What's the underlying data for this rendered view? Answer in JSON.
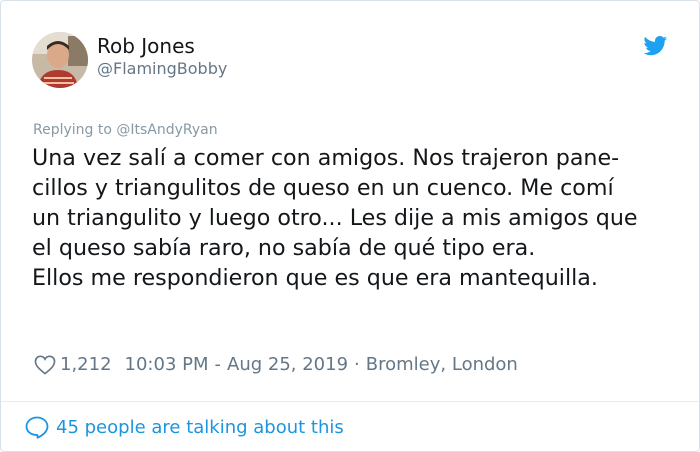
{
  "tweet": {
    "author": {
      "name": "Rob Jones",
      "handle": "@FlamingBobby"
    },
    "reply": {
      "prefix": "Replying to",
      "to": "@ItsAndyRyan"
    },
    "lines": [
      "Una vez salí a comer con amigos. Nos trajeron pane-",
      "cillos y triangulitos de queso en un cuenco. Me comí",
      "un triangulito y luego otro... Les dije a mis amigos que",
      "el queso sabía raro, no sabía de qué tipo era.",
      "Ellos me respondieron que es que era mantequilla."
    ],
    "likes": "1,212",
    "time": "10:03 PM",
    "date_sep": "-",
    "date": "Aug 25, 2019",
    "dot": "·",
    "location": "Bromley, London",
    "talking": "45 people are talking about this"
  },
  "colors": {
    "twitter_blue": "#1da1f2",
    "link_blue": "#1b95e0",
    "text": "#14171a",
    "muted": "#657786"
  },
  "icons": {
    "brand": "twitter-bird-icon",
    "like": "heart-icon",
    "conversation": "speech-bubble-icon"
  }
}
